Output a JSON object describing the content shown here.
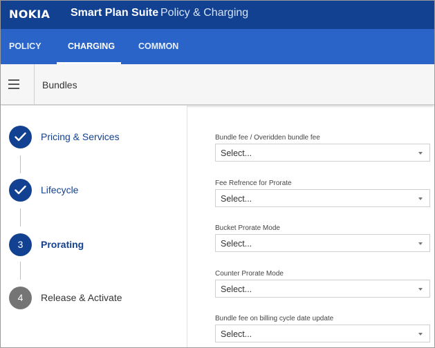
{
  "header": {
    "logo": "NOKIA",
    "product": "Smart Plan Suite",
    "section": "Policy & Charging"
  },
  "tabs": [
    {
      "label": "POLICY",
      "active": false
    },
    {
      "label": "CHARGING",
      "active": true
    },
    {
      "label": "COMMON",
      "active": false
    }
  ],
  "subheader": {
    "title": "Bundles"
  },
  "steps": [
    {
      "label": "Pricing & Services",
      "status": "complete",
      "marker": ""
    },
    {
      "label": "Lifecycle",
      "status": "complete",
      "marker": ""
    },
    {
      "label": "Prorating",
      "status": "current",
      "marker": "3"
    },
    {
      "label": "Release & Activate",
      "status": "pending",
      "marker": "4"
    }
  ],
  "form": {
    "fields": [
      {
        "label": "Bundle fee / Overidden bundle fee",
        "value": "Select..."
      },
      {
        "label": "Fee Refrence for Prorate",
        "value": "Select..."
      },
      {
        "label": "Bucket Prorate Mode",
        "value": "Select..."
      },
      {
        "label": "Counter Prorate Mode",
        "value": "Select..."
      },
      {
        "label": "Bundle fee on billing cycle date update",
        "value": "Select..."
      }
    ]
  },
  "colors": {
    "topbar": "#124191",
    "tabbar": "#2b64c8",
    "step_active": "#124191",
    "step_pending": "#757575"
  }
}
